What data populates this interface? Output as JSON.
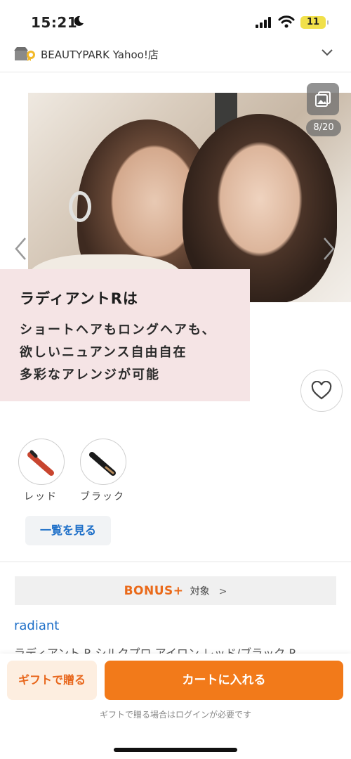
{
  "status_bar": {
    "time": "15:21",
    "battery": "11"
  },
  "store": {
    "name": "BEAUTYPARK Yahoo!店"
  },
  "gallery": {
    "counter": "8/20"
  },
  "caption": {
    "heading": "ラディアントRは",
    "line1": "ショートヘアもロングヘアも、",
    "line2": "欲しいニュアンス自由自在",
    "line3": "多彩なアレンジが可能"
  },
  "variants": [
    {
      "label": "レッド",
      "color": "#c8452f"
    },
    {
      "label": "ブラック",
      "color": "#1b1b1b"
    }
  ],
  "list_button": "一覧を見る",
  "bonus": {
    "logo": "BONUS+",
    "text": "対象",
    "chevron": ">"
  },
  "product": {
    "brand": "radiant",
    "title": "ラディアント R シルクプロ アイロン レッド/ブラック R"
  },
  "bottom": {
    "gift_label": "ギフトで贈る",
    "cart_label": "カートに入れる",
    "note": "ギフトで贈る場合はログインが必要です"
  },
  "colors": {
    "accent": "#f27a1a",
    "link": "#1e6fc8",
    "caption_bg": "#f5e4e5"
  }
}
